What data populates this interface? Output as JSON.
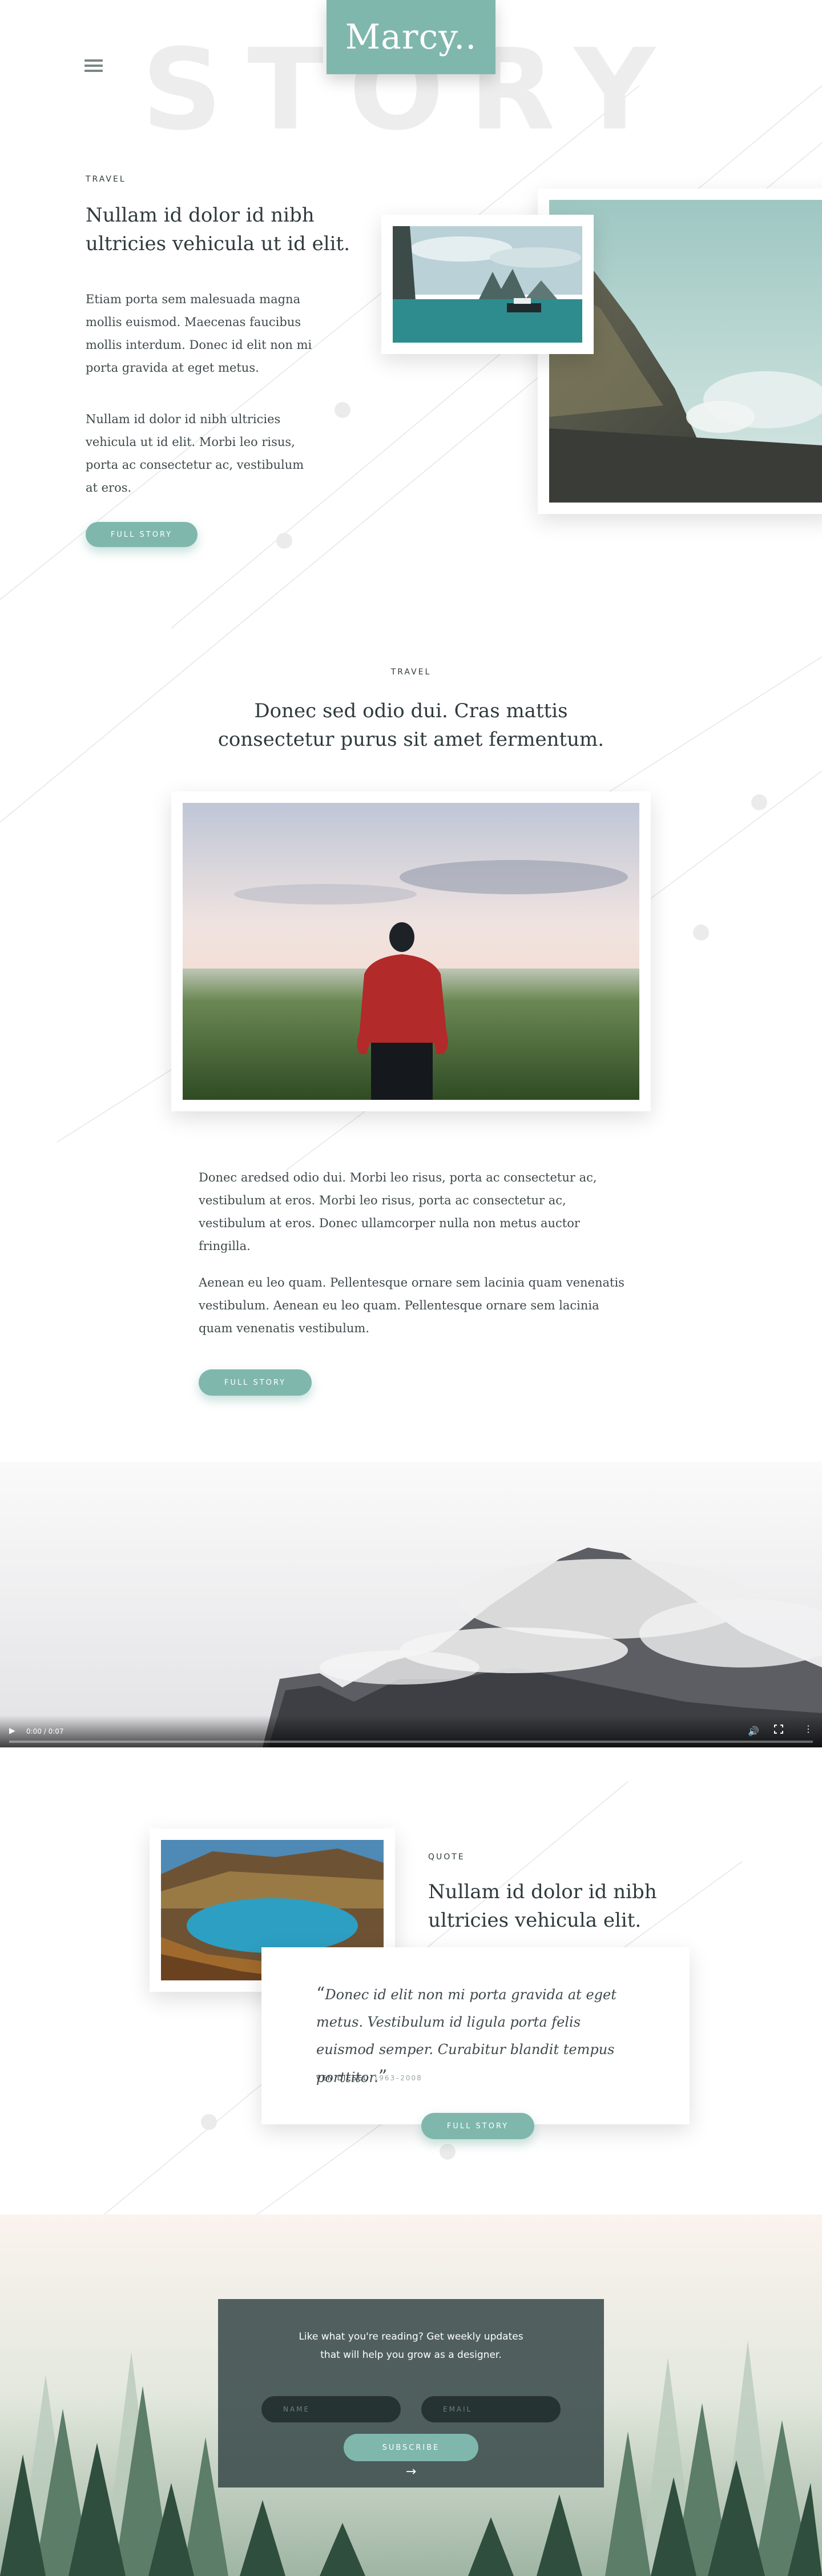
{
  "header": {
    "logo": "Marcy..",
    "background_word": "STORY",
    "menu_icon": "hamburger-menu-icon"
  },
  "post1": {
    "category": "TRAVEL",
    "title": "Nullam id dolor id nibh ultricies vehicula ut id elit.",
    "paragraphs": [
      "Etiam porta sem malesuada magna mollis euismod. Maecenas faucibus mollis interdum. Donec id elit non mi porta gravida at eget metus.",
      "Nullam id dolor id nibh ultricies vehicula ut id elit. Morbi leo risus, porta ac consectetur ac, vestibulum at eros."
    ],
    "button": "FULL STORY"
  },
  "post2": {
    "category": "TRAVEL",
    "title": "Donec sed odio dui. Cras mattis consectetur purus sit amet fermentum.",
    "paragraphs": [
      "Donec aredsed odio dui. Morbi leo risus, porta ac consectetur ac, vestibulum at eros. Morbi leo risus, porta ac consectetur ac, vestibulum at eros. Donec ullamcorper nulla non metus auctor fringilla.",
      "Aenean eu leo quam. Pellentesque ornare sem lacinia quam venenatis vestibulum. Aenean eu leo quam. Pellentesque ornare sem lacinia quam venenatis vestibulum."
    ],
    "button": "FULL STORY"
  },
  "video": {
    "time": "0:00 / 0:07",
    "progress": 0
  },
  "quote_post": {
    "category": "QUOTE",
    "title": "Nullam id dolor id nibh ultricies vehicula elit.",
    "quote": "Donec id elit non mi porta gravida at eget metus. Vestibulum id ligula porta felis euismod semper. Curabitur blandit tempus porttitor.",
    "open_mark": "“",
    "close_mark": "”",
    "author": "VEN DIESEL",
    "years": "1963–2008",
    "button": "FULL STORY"
  },
  "newsletter": {
    "line1": "Like what you're reading? Get weekly updates",
    "line2": "that will help you grow as a designer.",
    "name_placeholder": "NAME",
    "email_placeholder": "EMAIL",
    "button": "SUBSCRIBE",
    "arrow": "→"
  },
  "colors": {
    "accent": "#7fb7ad",
    "text": "#2f3a3c",
    "newsletter_bg": "#374848"
  }
}
